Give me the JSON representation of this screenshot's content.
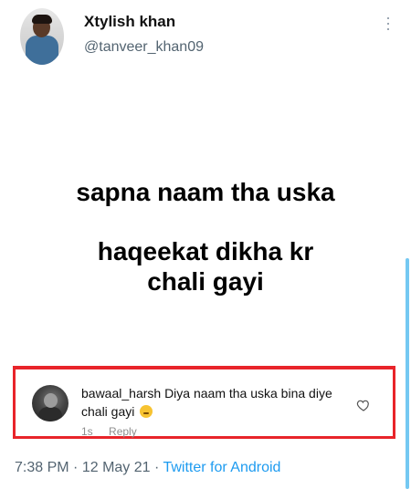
{
  "author": {
    "display_name": "Xtylish khan",
    "handle": "@tanveer_khan09"
  },
  "tweet": {
    "lines": [
      "sapna naam tha uska",
      "haqeekat dikha kr",
      "chali gayi"
    ]
  },
  "embedded_reply": {
    "username": "bawaal_harsh",
    "text": "Diya naam tha uska bina diye chali gayi",
    "time": "1s",
    "reply_label": "Reply"
  },
  "footer": {
    "time": "7:38 PM",
    "date": "12 May 21",
    "separator": "·",
    "source": "Twitter for Android"
  },
  "colors": {
    "highlight_border": "#e8242a",
    "link": "#1d9bf0",
    "secondary_text": "#536471"
  },
  "icons": {
    "menu": "more-vertical-icon",
    "like": "heart-outline-icon",
    "emoji": "grimacing-face-emoji"
  }
}
